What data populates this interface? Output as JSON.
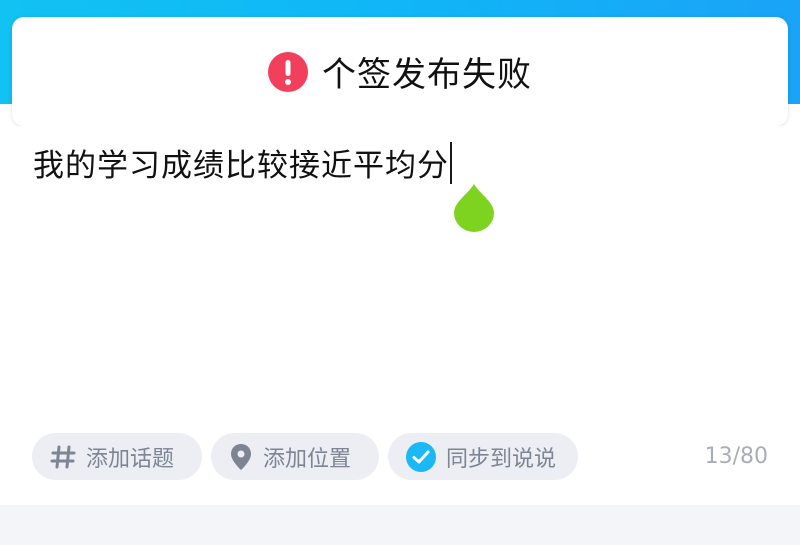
{
  "toast": {
    "icon": "exclamation-circle-icon",
    "message": "个签发布失败",
    "icon_color": "#f2405c"
  },
  "editor": {
    "content": "我的学习成绩比较接近平均分",
    "cursor_handle_color": "#7ed321"
  },
  "actions": {
    "topic": {
      "icon": "hash-icon",
      "label": "添加话题"
    },
    "location": {
      "icon": "location-pin-icon",
      "label": "添加位置"
    },
    "sync": {
      "icon": "check-circle-icon",
      "label": "同步到说说",
      "checked": true,
      "check_color": "#1ab8f4"
    }
  },
  "counter": {
    "text": "13/80"
  },
  "colors": {
    "header": "#12c2f3",
    "chip_background": "#eceef4",
    "chip_text": "#7d8595"
  }
}
